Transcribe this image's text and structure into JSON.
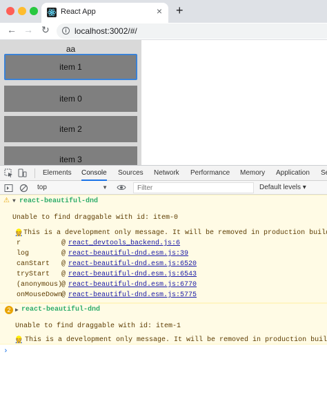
{
  "browser": {
    "tab_title": "React App",
    "tab_close": "×",
    "new_tab": "+",
    "url": "localhost:3002/#/",
    "nav": {
      "back": "←",
      "forward": "→",
      "reload": "↻"
    }
  },
  "page": {
    "list_title": "aa",
    "items": [
      "item 1",
      "item 0",
      "item 2",
      "item 3"
    ]
  },
  "devtools": {
    "tabs": [
      "Elements",
      "Console",
      "Sources",
      "Network",
      "Performance",
      "Memory",
      "Application",
      "Se"
    ],
    "active_tab": "Console",
    "context": "top",
    "filter_placeholder": "Filter",
    "levels": "Default levels ▾",
    "messages": [
      {
        "tag": "react-beautiful-dnd",
        "text": "Unable to find draggable with id: item-0",
        "note": "This is a development only message. It will be removed in production builds.",
        "stack": [
          {
            "fn": "r",
            "file": "react_devtools_backend.js:6"
          },
          {
            "fn": "log",
            "file": "react-beautiful-dnd.esm.js:39"
          },
          {
            "fn": "canStart",
            "file": "react-beautiful-dnd.esm.js:6520"
          },
          {
            "fn": "tryStart",
            "file": "react-beautiful-dnd.esm.js:6543"
          },
          {
            "fn": "(anonymous)",
            "file": "react-beautiful-dnd.esm.js:6770"
          },
          {
            "fn": "onMouseDown",
            "file": "react-beautiful-dnd.esm.js:5775"
          }
        ]
      },
      {
        "count": "2",
        "tag": "react-beautiful-dnd",
        "text": "Unable to find draggable with id: item-1",
        "note": "This is a development only message. It will be removed in production builds."
      }
    ],
    "prompt": "›"
  },
  "colors": {
    "accent": "#1a73e8",
    "warning_bg": "#fffbe5",
    "tag_green": "#2fad6b",
    "item_bg": "#7f7f7f",
    "list_bg": "#d9d9d9"
  }
}
